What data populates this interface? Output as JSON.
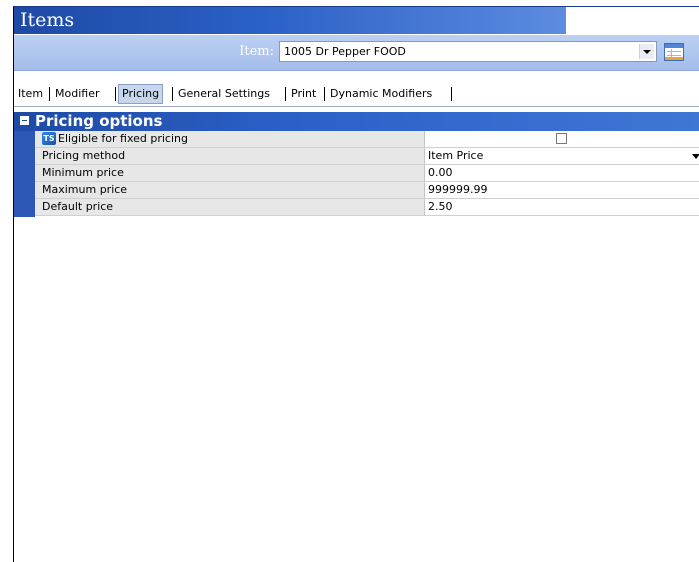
{
  "window": {
    "title": "Items"
  },
  "item_selector": {
    "label": "Item:",
    "value": "1005 Dr Pepper FOOD",
    "icons": [
      "chevron-down-icon",
      "grid-icon"
    ]
  },
  "tabs": [
    {
      "label": "Item",
      "active": false
    },
    {
      "label": "Modifier",
      "active": false
    },
    {
      "label": "Pricing",
      "active": true
    },
    {
      "label": "General Settings",
      "active": false
    },
    {
      "label": "Print",
      "active": false
    },
    {
      "label": "Dynamic Modifiers",
      "active": false
    }
  ],
  "pricing": {
    "group_title": "Pricing options",
    "rows": [
      {
        "name": "Eligible for fixed pricing",
        "icon": "ts-icon",
        "type": "checkbox",
        "checked": false,
        "value": ""
      },
      {
        "name": "Pricing method",
        "type": "dropdown",
        "value": "Item Price"
      },
      {
        "name": "Minimum price",
        "type": "text",
        "value": "0.00"
      },
      {
        "name": "Maximum price",
        "type": "text",
        "value": "999999.99"
      },
      {
        "name": "Default price",
        "type": "text",
        "value": "2.50"
      }
    ]
  },
  "colors": {
    "title_bar": "#2b60c6",
    "item_bar": "#b0c6ef",
    "group_header": "#1e4aa6",
    "active_tab": "#c8d6ec"
  }
}
